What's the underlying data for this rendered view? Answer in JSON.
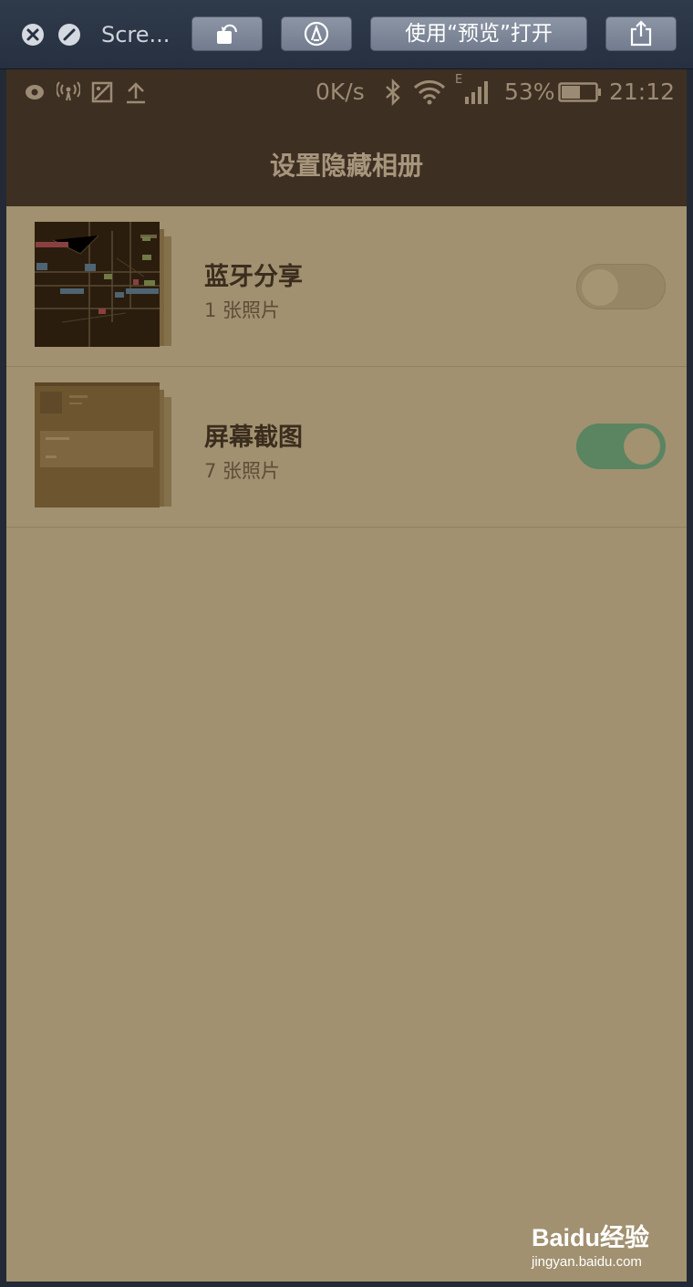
{
  "window": {
    "title": "Scre...",
    "open_with_preview_label": "使用“预览”打开",
    "icons": [
      "close-icon",
      "block-icon",
      "rotate-icon",
      "markup-icon",
      "share-icon"
    ]
  },
  "status_bar": {
    "icons": [
      "eye-icon",
      "hotspot-icon",
      "image-icon",
      "upload-icon",
      "bluetooth-icon",
      "wifi-icon",
      "signal-icon",
      "battery-icon"
    ],
    "network_speed": "0K/s",
    "network_type": "E",
    "battery": "53%",
    "time": "21:12"
  },
  "header": {
    "title": "设置隐藏相册"
  },
  "albums": [
    {
      "name": "蓝牙分享",
      "count": "1 张照片",
      "hidden": false
    },
    {
      "name": "屏幕截图",
      "count": "7 张照片",
      "hidden": true
    }
  ],
  "watermark": {
    "logo": "Baidu经验",
    "url": "jingyan.baidu.com"
  },
  "colors": {
    "toggle_on": "#5b8461",
    "header_bg": "#3d2f22",
    "content_bg": "#a19170"
  }
}
